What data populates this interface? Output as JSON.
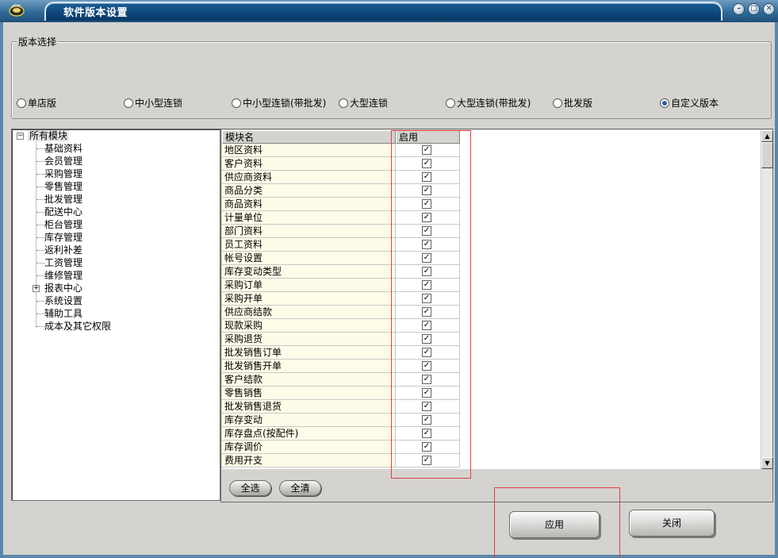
{
  "window": {
    "title": "软件版本设置",
    "controls": [
      "minimize-icon",
      "restore-icon",
      "close-icon"
    ]
  },
  "version_group": {
    "legend": "版本选择",
    "options": [
      {
        "label": "单店版",
        "selected": false
      },
      {
        "label": "中小型连锁",
        "selected": false
      },
      {
        "label": "中小型连锁(带批发)",
        "selected": false
      },
      {
        "label": "大型连锁",
        "selected": false
      },
      {
        "label": "大型连锁(带批发)",
        "selected": false
      },
      {
        "label": "批发版",
        "selected": false
      },
      {
        "label": "自定义版本",
        "selected": true
      }
    ]
  },
  "tree": {
    "root": "所有模块",
    "items": [
      "基础资料",
      "会员管理",
      "采购管理",
      "零售管理",
      "批发管理",
      "配送中心",
      "柜台管理",
      "库存管理",
      "返利补差",
      "工资管理",
      "维修管理",
      "报表中心",
      "系统设置",
      "辅助工具",
      "成本及其它权限"
    ]
  },
  "grid": {
    "columns": [
      "模块名",
      "启用"
    ],
    "rows": [
      {
        "name": "地区资料",
        "enabled": true
      },
      {
        "name": "客户资料",
        "enabled": true
      },
      {
        "name": "供应商资料",
        "enabled": true
      },
      {
        "name": "商品分类",
        "enabled": true
      },
      {
        "name": "商品资料",
        "enabled": true
      },
      {
        "name": "计量单位",
        "enabled": true
      },
      {
        "name": "部门资料",
        "enabled": true
      },
      {
        "name": "员工资料",
        "enabled": true
      },
      {
        "name": "帐号设置",
        "enabled": true
      },
      {
        "name": "库存变动类型",
        "enabled": true
      },
      {
        "name": "采购订单",
        "enabled": true
      },
      {
        "name": "采购开单",
        "enabled": true
      },
      {
        "name": "供应商结款",
        "enabled": true
      },
      {
        "name": "现款采购",
        "enabled": true
      },
      {
        "name": "采购退货",
        "enabled": true
      },
      {
        "name": "批发销售订单",
        "enabled": true
      },
      {
        "name": "批发销售开单",
        "enabled": true
      },
      {
        "name": "客户结款",
        "enabled": true
      },
      {
        "name": "零售销售",
        "enabled": true
      },
      {
        "name": "批发销售退货",
        "enabled": true
      },
      {
        "name": "库存变动",
        "enabled": true
      },
      {
        "name": "库存盘点(按配件)",
        "enabled": true
      },
      {
        "name": "库存调价",
        "enabled": true
      },
      {
        "name": "费用开支",
        "enabled": true
      }
    ],
    "select_all_label": "全选",
    "clear_all_label": "全清"
  },
  "footer": {
    "apply_label": "应用",
    "close_label": "关闭"
  },
  "colors": {
    "title_bar": "#2f6b98",
    "window_body": "#d4d3d0",
    "name_cell_bg": "#fefce8",
    "highlight_box": "#e04040"
  }
}
